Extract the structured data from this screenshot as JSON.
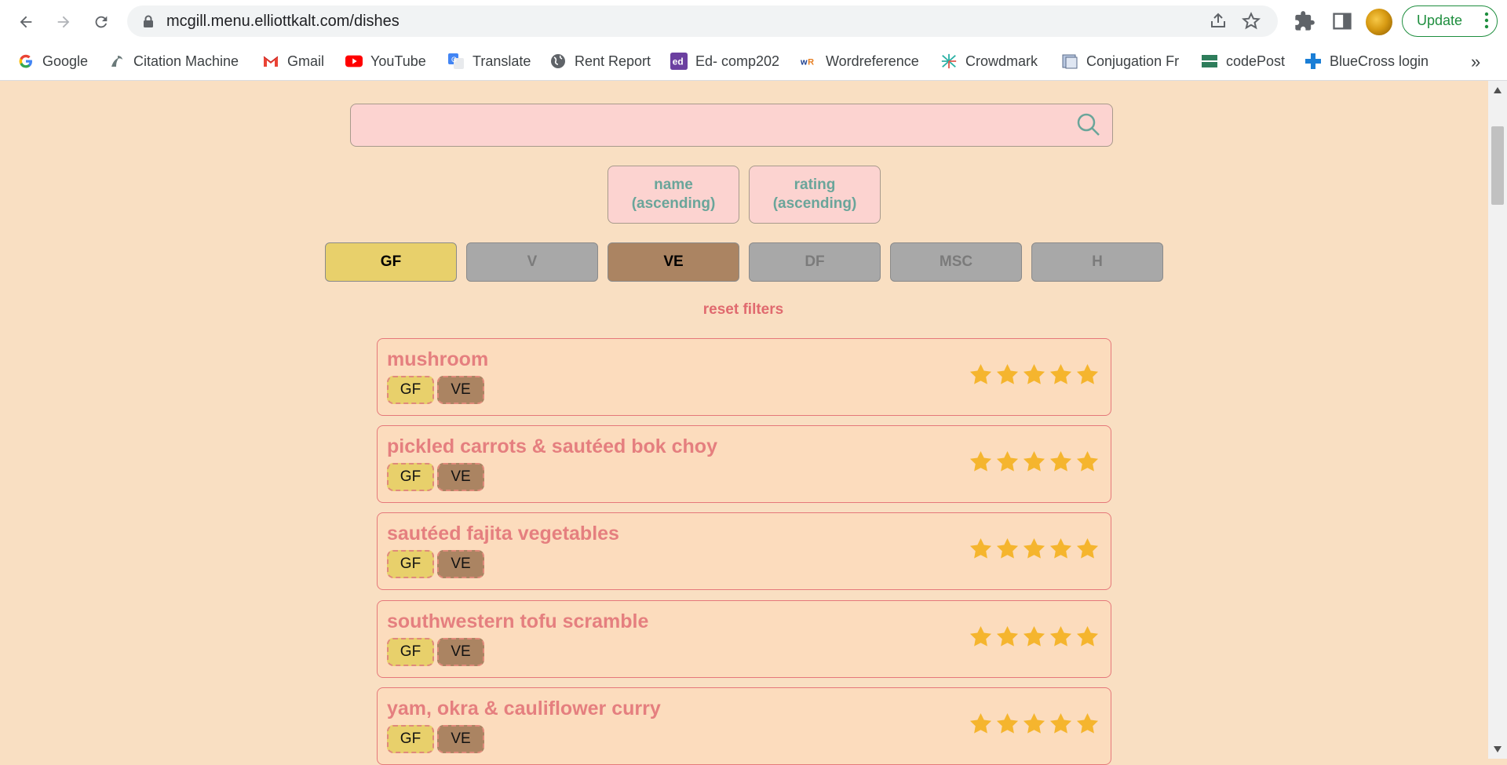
{
  "browser": {
    "url": "mcgill.menu.elliottkalt.com/dishes",
    "update_label": "Update",
    "bookmarks": [
      {
        "label": "Google",
        "icon": "google-icon"
      },
      {
        "label": "Citation Machine",
        "icon": "citation-machine-icon"
      },
      {
        "label": "Gmail",
        "icon": "gmail-icon"
      },
      {
        "label": "YouTube",
        "icon": "youtube-icon"
      },
      {
        "label": "Translate",
        "icon": "translate-icon"
      },
      {
        "label": "Rent Report",
        "icon": "globe-icon"
      },
      {
        "label": "Ed- comp202",
        "icon": "ed-icon"
      },
      {
        "label": "Wordreference",
        "icon": "wordreference-icon"
      },
      {
        "label": "Crowdmark",
        "icon": "crowdmark-icon"
      },
      {
        "label": "Conjugation Fr",
        "icon": "conjugation-icon"
      },
      {
        "label": "codePost",
        "icon": "codepost-icon"
      },
      {
        "label": "BlueCross login",
        "icon": "bluecross-icon"
      }
    ],
    "more": "»"
  },
  "search": {
    "placeholder": "",
    "value": ""
  },
  "sort": [
    {
      "line1": "name",
      "line2": "(ascending)"
    },
    {
      "line1": "rating",
      "line2": "(ascending)"
    }
  ],
  "filters": [
    {
      "label": "GF",
      "active": true
    },
    {
      "label": "V",
      "active": false
    },
    {
      "label": "VE",
      "active": true
    },
    {
      "label": "DF",
      "active": false
    },
    {
      "label": "MSC",
      "active": false
    },
    {
      "label": "H",
      "active": false
    }
  ],
  "reset_label": "reset filters",
  "dishes": [
    {
      "name": "mushroom",
      "tags": [
        "GF",
        "VE"
      ],
      "rating": 5
    },
    {
      "name": "pickled carrots & sautéed bok choy",
      "tags": [
        "GF",
        "VE"
      ],
      "rating": 5
    },
    {
      "name": "sautéed fajita vegetables",
      "tags": [
        "GF",
        "VE"
      ],
      "rating": 5
    },
    {
      "name": "southwestern tofu scramble",
      "tags": [
        "GF",
        "VE"
      ],
      "rating": 5
    },
    {
      "name": "yam, okra & cauliflower curry",
      "tags": [
        "GF",
        "VE"
      ],
      "rating": 5
    }
  ],
  "colors": {
    "page_bg": "#f9dfc2",
    "gf": "#e8d06b",
    "ve": "#ab8462",
    "inactive": "#a8a8a8",
    "accent_text": "#e57f7f",
    "star": "#f5b52e"
  }
}
